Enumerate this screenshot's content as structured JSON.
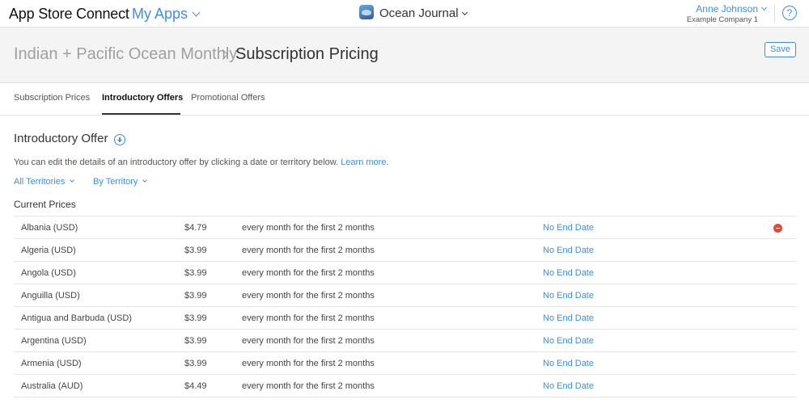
{
  "topbar": {
    "brand": "App Store Connect",
    "my_apps": "My Apps",
    "app_name": "Ocean Journal",
    "user_name": "Anne Johnson",
    "company": "Example Company 1",
    "help_glyph": "?"
  },
  "header": {
    "breadcrumb_parent": "Indian + Pacific Ocean Monthly",
    "title": "Subscription Pricing",
    "save_label": "Save"
  },
  "tabs": [
    {
      "label": "Subscription Prices",
      "active": false
    },
    {
      "label": "Introductory Offers",
      "active": true
    },
    {
      "label": "Promotional Offers",
      "active": false
    }
  ],
  "section": {
    "title": "Introductory Offer",
    "description": "You can edit the details of an introductory offer by clicking a date or territory below.",
    "learn_more": "Learn more",
    "description_end": ".",
    "filter_territories": "All Territories",
    "filter_view": "By Territory",
    "current_prices_label": "Current Prices"
  },
  "prices": [
    {
      "territory": "Albania (USD)",
      "price": "$4.79",
      "duration": "every month for the first 2 months",
      "end": "No End Date"
    },
    {
      "territory": "Algeria (USD)",
      "price": "$3.99",
      "duration": "every month for the first 2 months",
      "end": "No End Date"
    },
    {
      "territory": "Angola (USD)",
      "price": "$3.99",
      "duration": "every month for the first 2 months",
      "end": "No End Date"
    },
    {
      "territory": "Anguilla (USD)",
      "price": "$3.99",
      "duration": "every month for the first 2 months",
      "end": "No End Date"
    },
    {
      "territory": "Antigua and Barbuda (USD)",
      "price": "$3.99",
      "duration": "every month for the first 2 months",
      "end": "No End Date"
    },
    {
      "territory": "Argentina (USD)",
      "price": "$3.99",
      "duration": "every month for the first 2 months",
      "end": "No End Date"
    },
    {
      "territory": "Armenia (USD)",
      "price": "$3.99",
      "duration": "every month for the first 2 months",
      "end": "No End Date"
    },
    {
      "territory": "Australia (AUD)",
      "price": "$4.49",
      "duration": "every month for the first 2 months",
      "end": "No End Date"
    }
  ],
  "colors": {
    "accent": "#3d8fe0",
    "remove": "#e14b3b",
    "header_bg": "#f4f4f4"
  },
  "icons": [
    "chevron-down-icon",
    "app-icon",
    "help-icon",
    "breadcrumb-chevron-icon",
    "add-icon",
    "remove-icon"
  ]
}
